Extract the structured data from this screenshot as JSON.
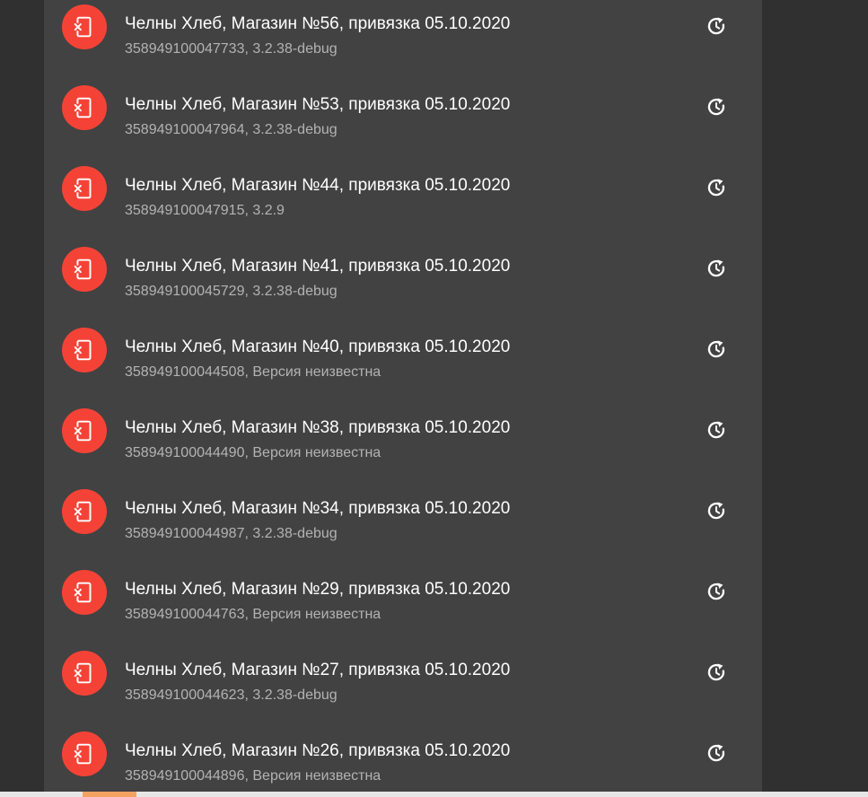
{
  "colors": {
    "background": "#303030",
    "panel": "#424242",
    "avatar": "#f44336",
    "title": "#ffffff",
    "subtitle": "#b3b3b3"
  },
  "icons": {
    "avatar_icon": "phonelink-erase-icon",
    "action_icon": "restore-icon"
  },
  "devices": [
    {
      "title": "Челны Хлеб, Магазин №56, привязка 05.10.2020",
      "subtitle": "358949100047733, 3.2.38-debug"
    },
    {
      "title": "Челны Хлеб, Магазин №53, привязка 05.10.2020",
      "subtitle": "358949100047964, 3.2.38-debug"
    },
    {
      "title": "Челны Хлеб, Магазин №44, привязка 05.10.2020",
      "subtitle": "358949100047915, 3.2.9"
    },
    {
      "title": "Челны Хлеб, Магазин №41, привязка 05.10.2020",
      "subtitle": "358949100045729, 3.2.38-debug"
    },
    {
      "title": "Челны Хлеб, Магазин №40, привязка 05.10.2020",
      "subtitle": "358949100044508, Версия неизвестна"
    },
    {
      "title": "Челны Хлеб, Магазин №38, привязка 05.10.2020",
      "subtitle": "358949100044490, Версия неизвестна"
    },
    {
      "title": "Челны Хлеб, Магазин №34, привязка 05.10.2020",
      "subtitle": "358949100044987, 3.2.38-debug"
    },
    {
      "title": "Челны Хлеб, Магазин №29, привязка 05.10.2020",
      "subtitle": "358949100044763, Версия неизвестна"
    },
    {
      "title": "Челны Хлеб, Магазин №27, привязка 05.10.2020",
      "subtitle": "358949100044623, 3.2.38-debug"
    },
    {
      "title": "Челны Хлеб, Магазин №26, привязка 05.10.2020",
      "subtitle": "358949100044896, Версия неизвестна"
    }
  ]
}
